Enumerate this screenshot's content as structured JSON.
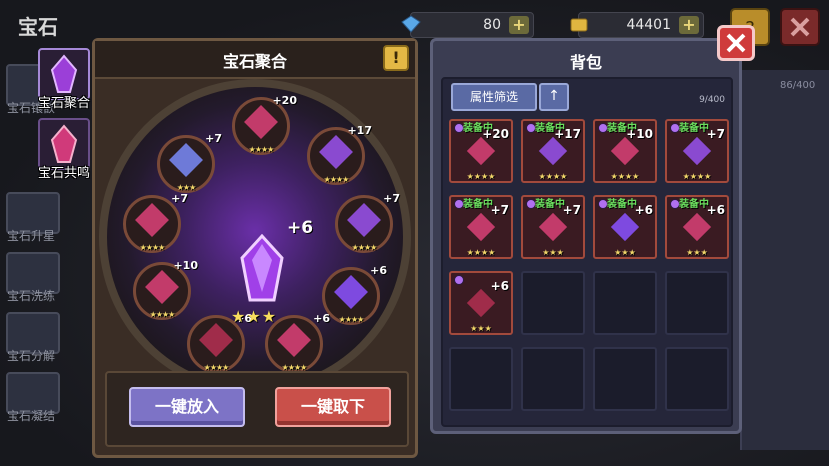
{
  "page_title": "宝石",
  "currencies": [
    {
      "icon": "diamond-icon",
      "amount": "80"
    },
    {
      "icon": "gold-coins-icon",
      "amount": "44401"
    }
  ],
  "left_menu": [
    {
      "label": "宝石镶嵌",
      "icon": "gem-socket-icon"
    },
    {
      "label": "宝石升星",
      "icon": "star-icon"
    },
    {
      "label": "宝石洗练",
      "icon": "refine-icon"
    },
    {
      "label": "宝石分解",
      "icon": "decompose-icon"
    },
    {
      "label": "宝石凝结",
      "icon": "condense-icon"
    }
  ],
  "tabs": [
    {
      "label": "宝石聚合",
      "active": true,
      "icon": "purple-gem-icon"
    },
    {
      "label": "宝石共鸣",
      "active": false,
      "icon": "resonance-gem-icon"
    }
  ],
  "fusion": {
    "title": "宝石聚合",
    "info_icon": "!",
    "center": {
      "level": "+6",
      "stars": "★★★"
    },
    "slots": [
      {
        "level": "+20",
        "stars": "★★★★"
      },
      {
        "level": "+17",
        "stars": "★★★★"
      },
      {
        "level": "+7",
        "stars": "★★★★"
      },
      {
        "level": "+6",
        "stars": "★★★★"
      },
      {
        "level": "+6",
        "stars": "★★★★"
      },
      {
        "level": "+6",
        "stars": "★★★★"
      },
      {
        "level": "+10",
        "stars": "★★★★"
      },
      {
        "level": "+7",
        "stars": "★★★★"
      },
      {
        "level": "+7",
        "stars": "★★★"
      }
    ],
    "put_all_label": "一键放入",
    "take_all_label": "一键取下"
  },
  "backpack": {
    "title": "背包",
    "filter_label": "属性筛选",
    "sort_icon": "↑",
    "capacity": "9/400",
    "items": [
      {
        "equipped": "装备中",
        "level": "+20",
        "stars": "★★★★",
        "color": "#c23b6a"
      },
      {
        "equipped": "装备中",
        "level": "+17",
        "stars": "★★★★",
        "color": "#8a4ad0"
      },
      {
        "equipped": "装备中",
        "level": "+10",
        "stars": "★★★★",
        "color": "#c23b6a"
      },
      {
        "equipped": "装备中",
        "level": "+7",
        "stars": "★★★★",
        "color": "#8a4ad0"
      },
      {
        "equipped": "装备中",
        "level": "+7",
        "stars": "★★★★",
        "color": "#c23b6a"
      },
      {
        "equipped": "装备中",
        "level": "+7",
        "stars": "★★★",
        "color": "#c23b6a"
      },
      {
        "equipped": "装备中",
        "level": "+6",
        "stars": "★★★",
        "color": "#7e4ae0"
      },
      {
        "equipped": "装备中",
        "level": "+6",
        "stars": "★★★",
        "color": "#c23b6a"
      },
      {
        "equipped": "",
        "level": "+6",
        "stars": "★★★",
        "color": "#a02c4a"
      }
    ]
  },
  "behind_capacity": "86/400"
}
